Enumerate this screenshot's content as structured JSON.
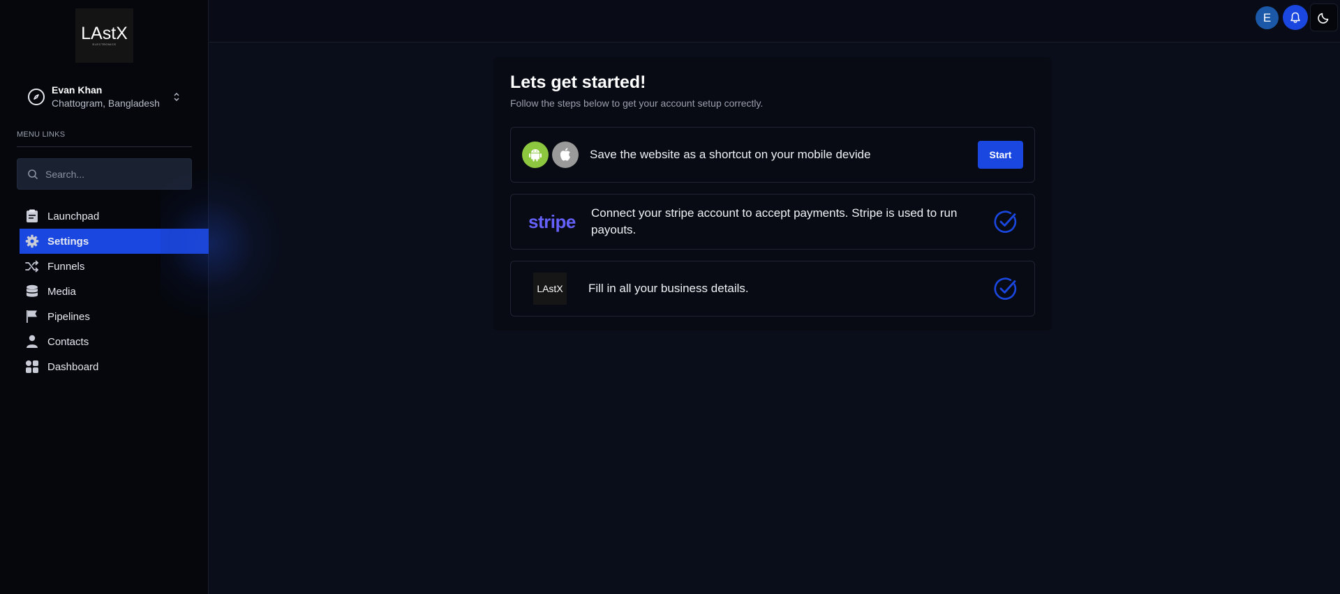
{
  "brand": {
    "logo_text": "LAstX",
    "logo_sub": "ELECTRONICS"
  },
  "user": {
    "name": "Evan Khan",
    "location": "Chattogram, Bangladesh",
    "avatar_initial": "E"
  },
  "sidebar": {
    "menu_heading": "MENU LINKS",
    "search_placeholder": "Search...",
    "items": [
      {
        "label": "Launchpad",
        "icon": "clipboard-icon",
        "active": false
      },
      {
        "label": "Settings",
        "icon": "gear-icon",
        "active": true
      },
      {
        "label": "Funnels",
        "icon": "shuffle-icon",
        "active": false
      },
      {
        "label": "Media",
        "icon": "database-icon",
        "active": false
      },
      {
        "label": "Pipelines",
        "icon": "flag-icon",
        "active": false
      },
      {
        "label": "Contacts",
        "icon": "person-icon",
        "active": false
      },
      {
        "label": "Dashboard",
        "icon": "grid-icon",
        "active": false
      }
    ]
  },
  "main": {
    "title": "Lets get started!",
    "subtitle": "Follow the steps below to get your account setup correctly.",
    "steps": [
      {
        "text": "Save the website as a shortcut on your mobile devide",
        "action_label": "Start",
        "icons": [
          "android-icon",
          "apple-icon"
        ]
      },
      {
        "text": "Connect your stripe account to accept payments. Stripe is used to run payouts.",
        "logo_text": "stripe",
        "status": "completed"
      },
      {
        "text": "Fill in all your business details.",
        "logo_text": "LAstX",
        "status": "completed"
      }
    ]
  },
  "colors": {
    "accent": "#1a47e0",
    "background": "#0a0e1a",
    "sidebar": "#05070d",
    "stripe": "#6461fc",
    "android": "#8dc63f"
  }
}
